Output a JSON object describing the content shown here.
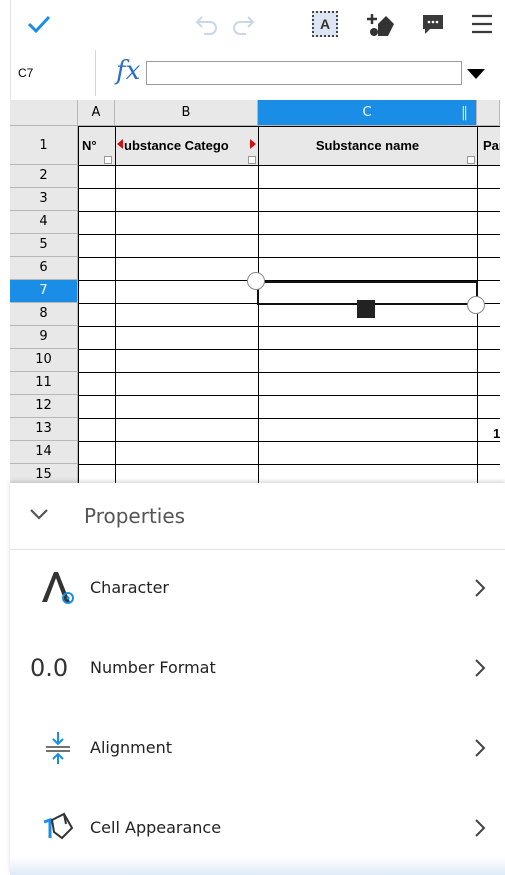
{
  "toolbar": {
    "confirm_icon": "checkmark-icon",
    "undo_icon": "undo-icon",
    "redo_icon": "redo-icon",
    "text_select_label": "A",
    "add_icon": "add-shape-icon",
    "comment_icon": "comment-icon",
    "menu_icon": "hamburger-menu-icon"
  },
  "formula_bar": {
    "cell_ref": "C7",
    "fx_label": "fx",
    "value": ""
  },
  "sheet": {
    "columns": [
      "A",
      "B",
      "C"
    ],
    "selected_column": "C",
    "rows": [
      "1",
      "2",
      "3",
      "4",
      "5",
      "6",
      "7",
      "8",
      "9",
      "10",
      "11",
      "12",
      "13",
      "14",
      "15"
    ],
    "selected_row": "7",
    "header_cells": {
      "a1": "N°",
      "b1": "ubstance Catego",
      "c1": "Substance name",
      "d1": "Par"
    },
    "d13": "1"
  },
  "properties": {
    "title": "Properties",
    "items": [
      {
        "label": "Character",
        "icon": "character-format-icon"
      },
      {
        "label": "Number Format",
        "icon": "number-format-icon"
      },
      {
        "label": "Alignment",
        "icon": "alignment-icon"
      },
      {
        "label": "Cell Appearance",
        "icon": "paint-bucket-icon"
      }
    ]
  },
  "colors": {
    "accent": "#1a8ee6",
    "fx": "#2a6fc9",
    "header_bg": "#e8e8e8"
  }
}
